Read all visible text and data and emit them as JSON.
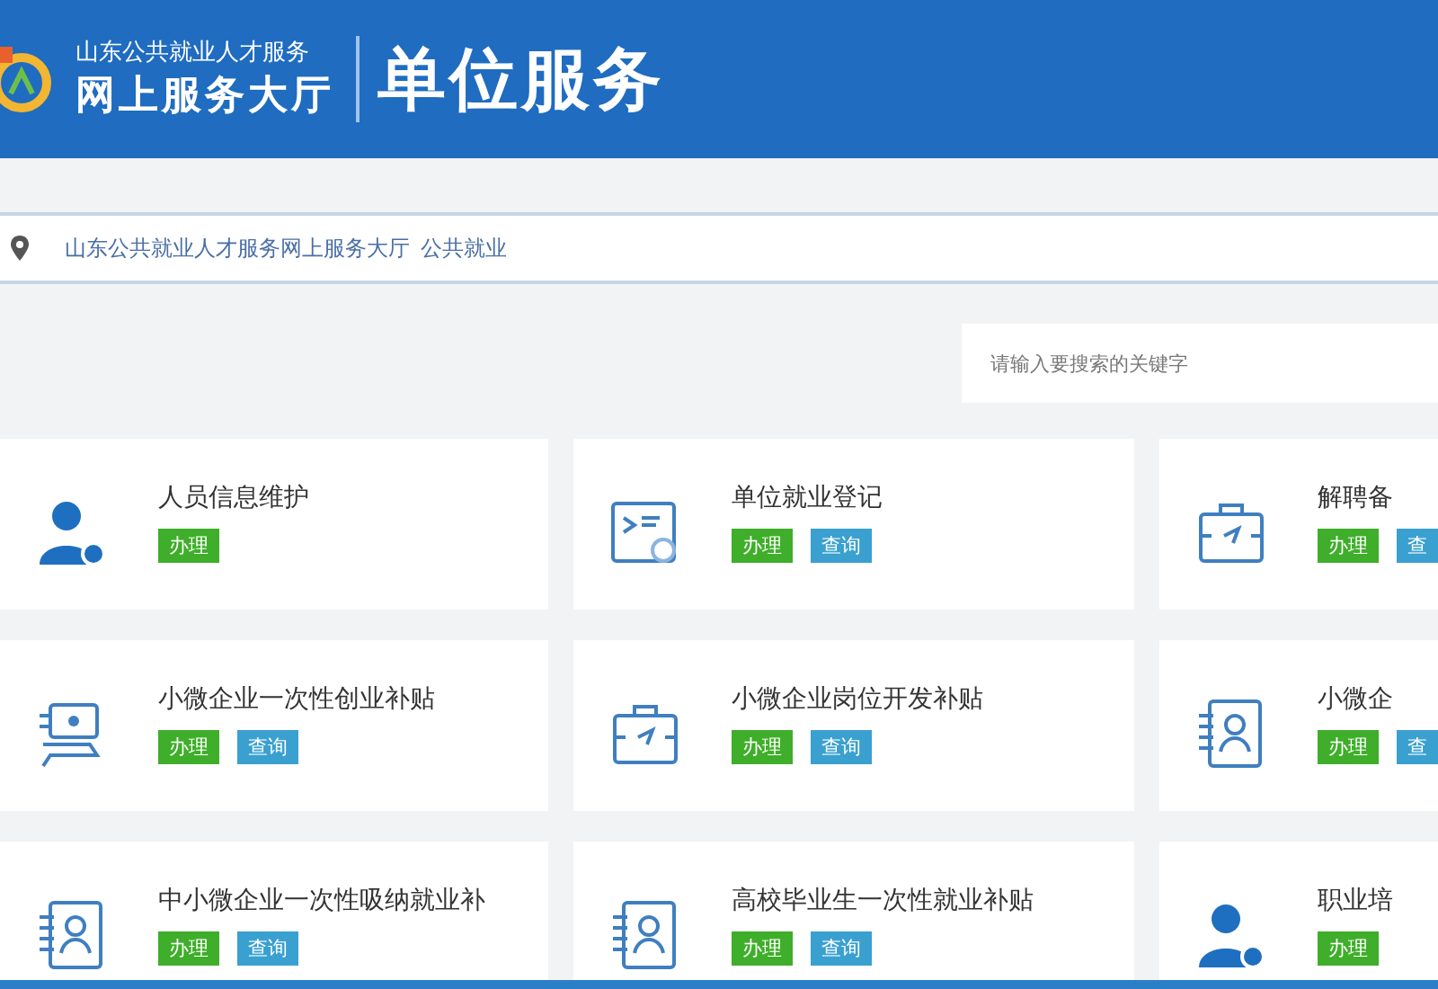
{
  "header": {
    "org_name": "山东公共就业人才服务",
    "hall_name": "网上服务大厅",
    "section_title": "单位服务"
  },
  "breadcrumb": {
    "path": "山东公共就业人才服务网上服务大厅",
    "current": "公共就业"
  },
  "search": {
    "placeholder": "请输入要搜索的关键字"
  },
  "services": [
    {
      "title": "人员信息维护",
      "kind": "person",
      "actions": [
        {
          "label": "办理",
          "kind": "handle"
        }
      ]
    },
    {
      "title": "单位就业登记",
      "kind": "document",
      "actions": [
        {
          "label": "办理",
          "kind": "handle"
        },
        {
          "label": "查询",
          "kind": "query"
        }
      ]
    },
    {
      "title": "解聘备",
      "kind": "briefcase",
      "actions": [
        {
          "label": "办理",
          "kind": "handle"
        },
        {
          "label": "查",
          "kind": "query"
        }
      ]
    },
    {
      "title": "小微企业一次性创业补贴",
      "kind": "cash",
      "actions": [
        {
          "label": "办理",
          "kind": "handle"
        },
        {
          "label": "查询",
          "kind": "query"
        }
      ]
    },
    {
      "title": "小微企业岗位开发补贴",
      "kind": "briefcase",
      "actions": [
        {
          "label": "办理",
          "kind": "handle"
        },
        {
          "label": "查询",
          "kind": "query"
        }
      ]
    },
    {
      "title": "小微企",
      "kind": "contact",
      "actions": [
        {
          "label": "办理",
          "kind": "handle"
        },
        {
          "label": "查",
          "kind": "query"
        }
      ]
    },
    {
      "title": "中小微企业一次性吸纳就业补",
      "kind": "contact",
      "actions": [
        {
          "label": "办理",
          "kind": "handle"
        },
        {
          "label": "查询",
          "kind": "query"
        }
      ]
    },
    {
      "title": "高校毕业生一次性就业补贴",
      "kind": "contact",
      "actions": [
        {
          "label": "办理",
          "kind": "handle"
        },
        {
          "label": "查询",
          "kind": "query"
        }
      ]
    },
    {
      "title": "职业培",
      "kind": "person",
      "actions": [
        {
          "label": "办理",
          "kind": "handle"
        }
      ]
    }
  ]
}
